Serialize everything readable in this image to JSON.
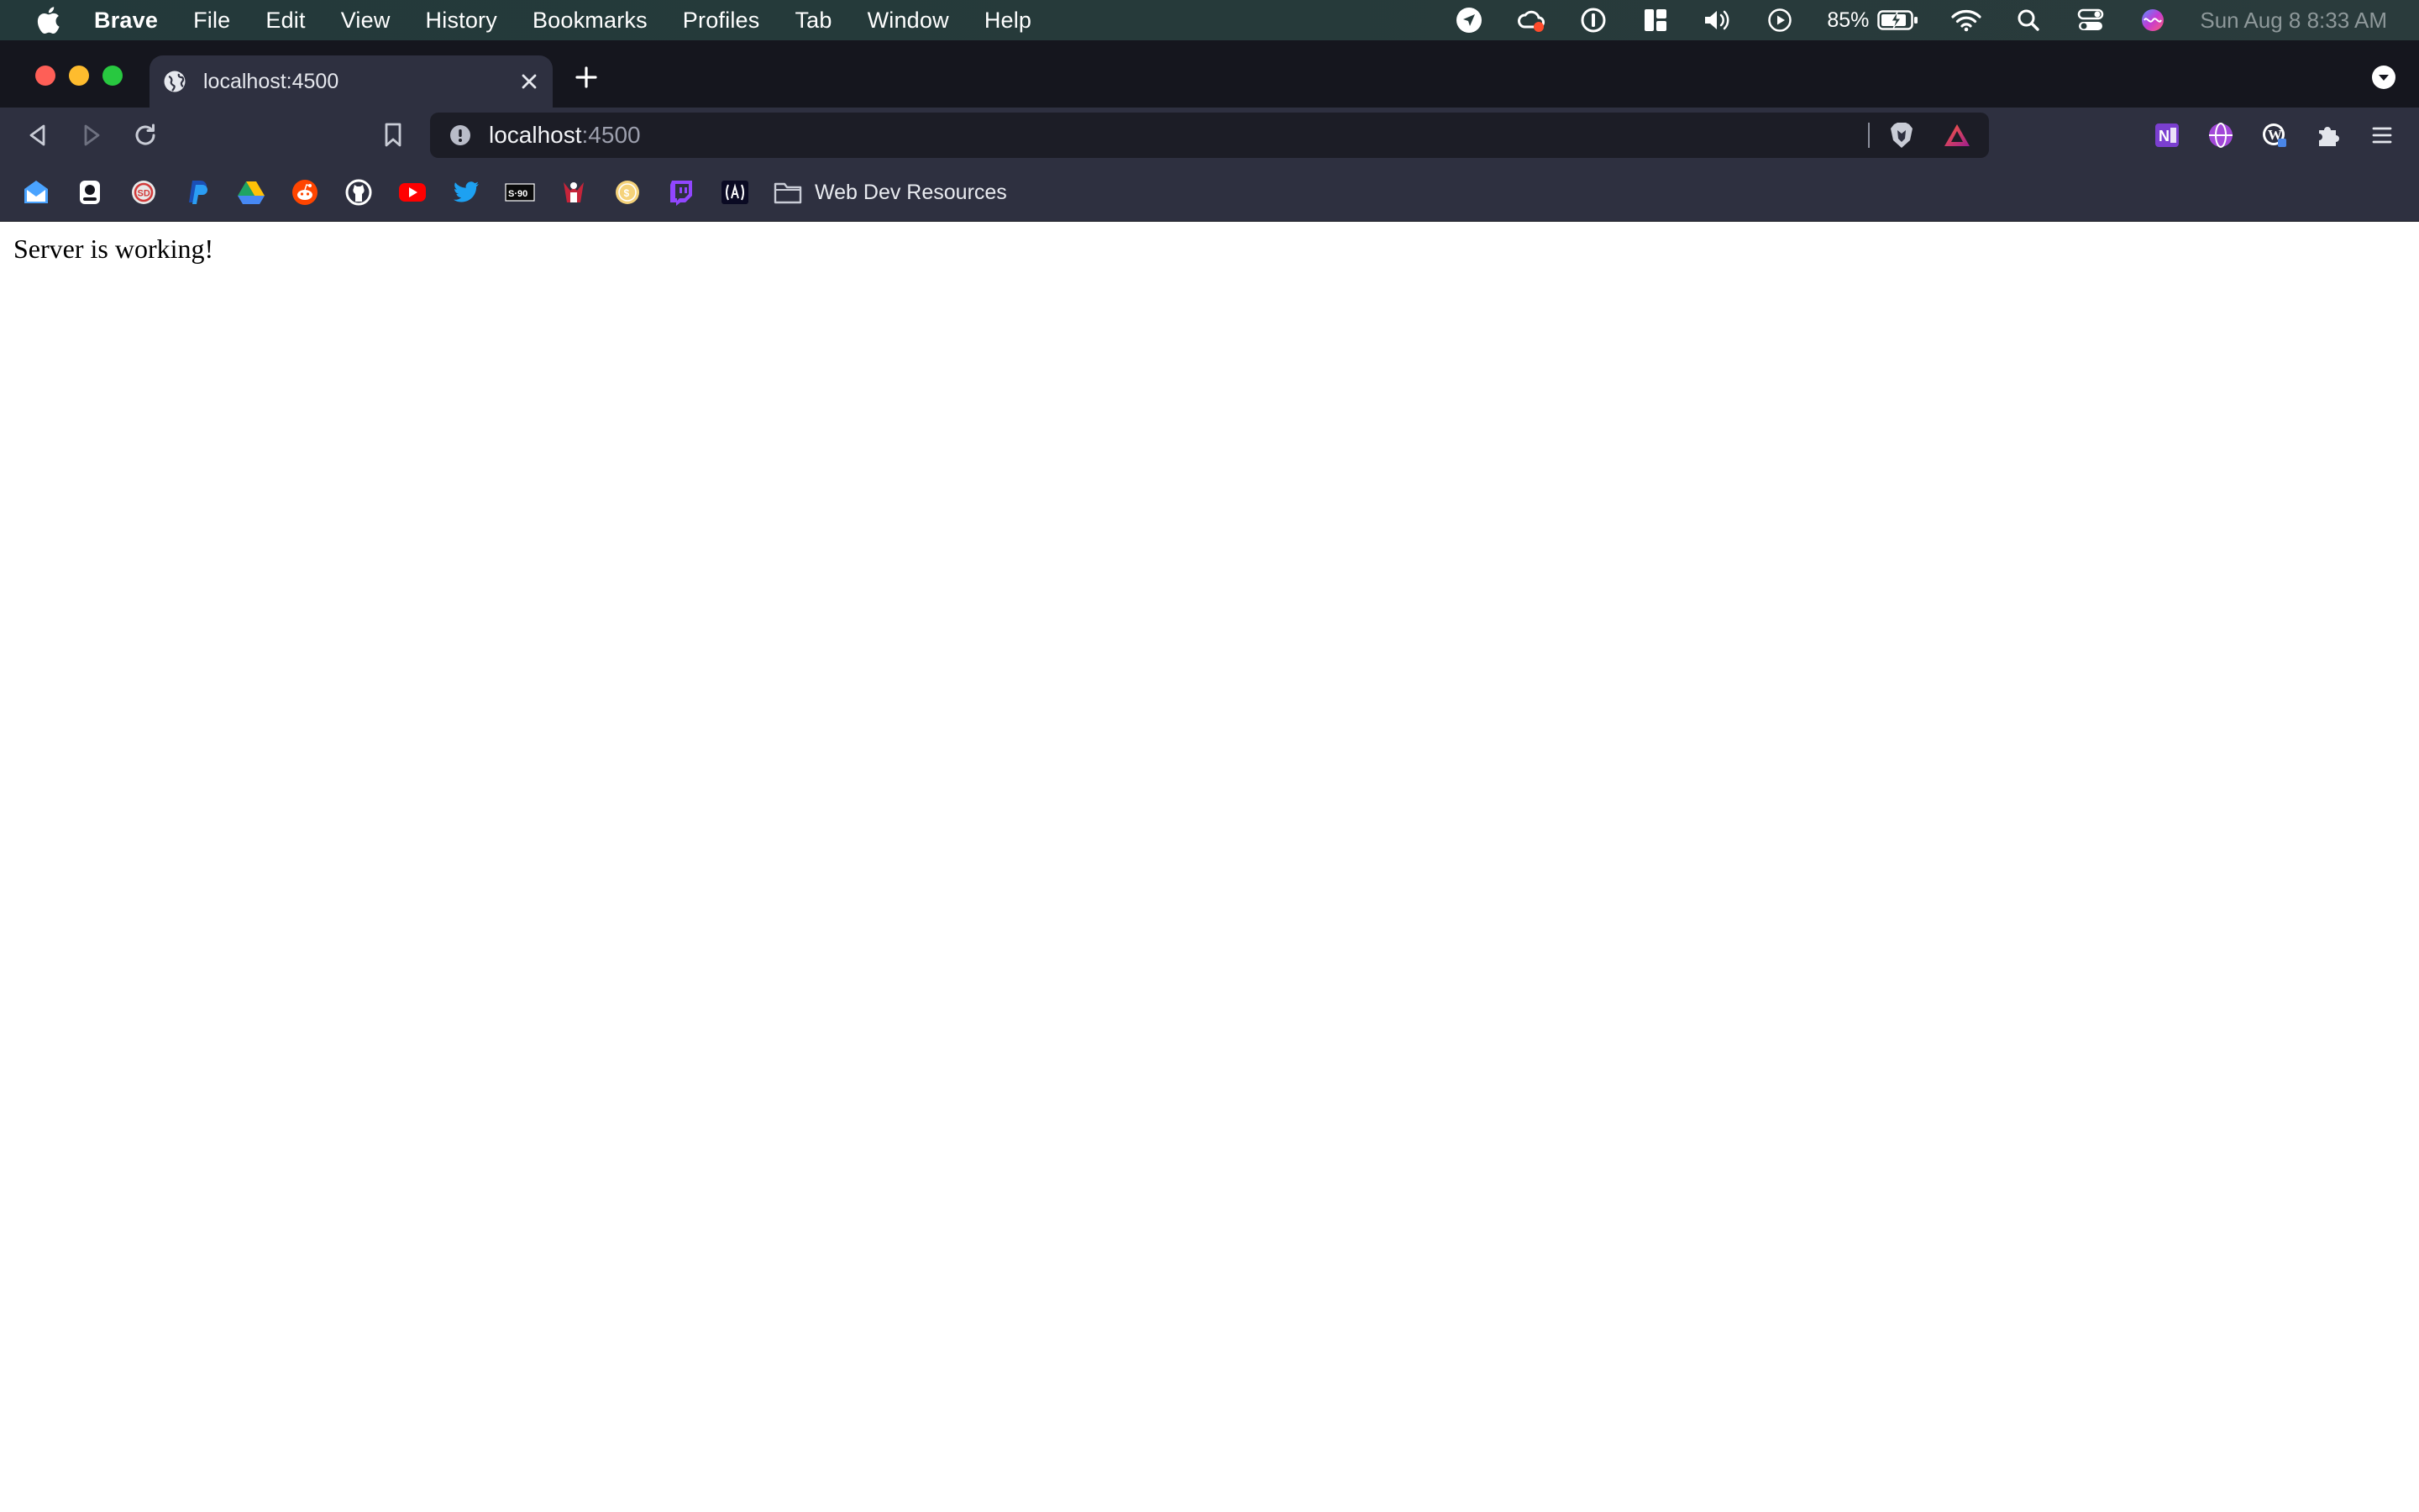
{
  "menubar": {
    "app_name": "Brave",
    "items": [
      "File",
      "Edit",
      "View",
      "History",
      "Bookmarks",
      "Profiles",
      "Tab",
      "Window",
      "Help"
    ],
    "status": {
      "battery": "85%",
      "clock": "Sun Aug 8  8:33 AM"
    }
  },
  "tab": {
    "title": "localhost:4500"
  },
  "address": {
    "host": "localhost",
    "port": ":4500"
  },
  "bookmarks": {
    "icons": [
      "mail-icon",
      "game-icon",
      "sd-icon",
      "paypal-icon",
      "google-drive-icon",
      "reddit-icon",
      "github-icon",
      "youtube-icon",
      "twitter-icon",
      "skillshare-icon",
      "gym-icon",
      "coin-icon",
      "twitch-icon",
      "code-icon"
    ],
    "folder_label": "Web Dev Resources"
  },
  "page": {
    "message": "Server is working!"
  },
  "colors": {
    "menubar": "#263a3a",
    "tabstrip": "#15161e",
    "toolbar": "#2e3040",
    "urlbar": "#1c1d26",
    "traffic_red": "#fe5f57",
    "traffic_yellow": "#febc2e",
    "traffic_green": "#28c840"
  }
}
